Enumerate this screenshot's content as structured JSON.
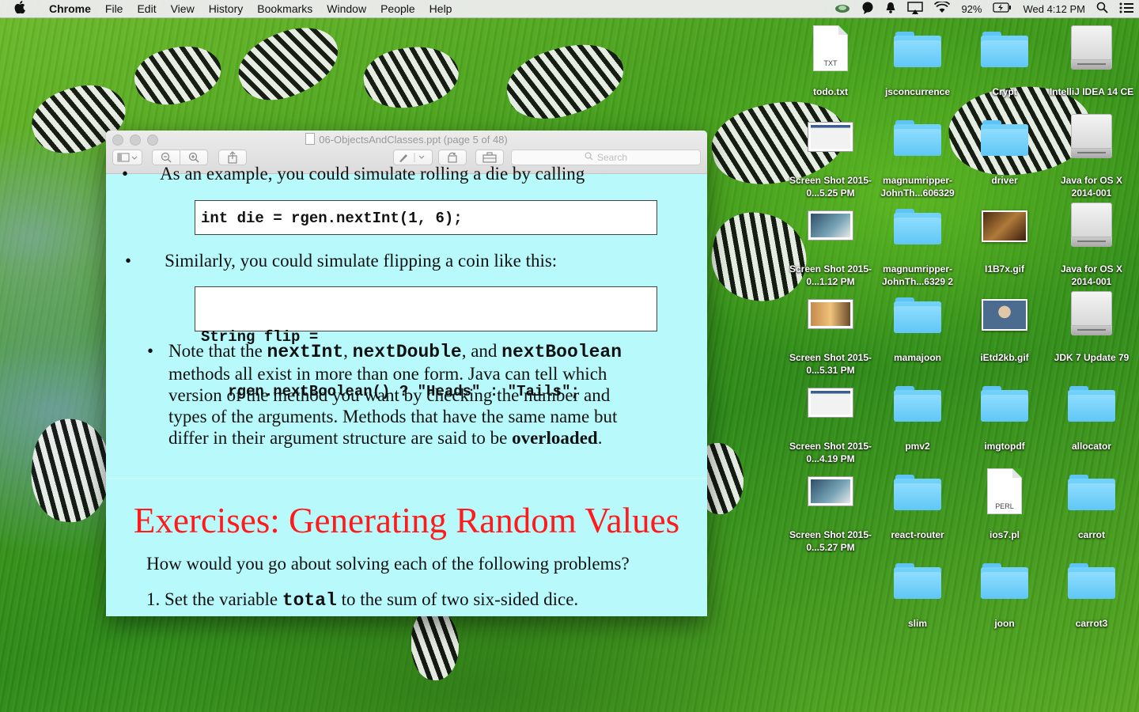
{
  "menubar": {
    "app_name": "Chrome",
    "items": [
      "File",
      "Edit",
      "View",
      "History",
      "Bookmarks",
      "Window",
      "People",
      "Help"
    ],
    "battery": "92%",
    "clock": "Wed 4:12 PM"
  },
  "preview": {
    "title": "06-ObjectsAndClasses.ppt (page 5 of 48)",
    "search_placeholder": "Search",
    "slide": {
      "line_cut": "As an example, you could simulate rolling a die by calling",
      "code1": "int die = rgen.nextInt(1, 6);",
      "bullet2": "Similarly, you could simulate flipping a coin like this:",
      "code2_line1": "String flip =",
      "code2_line2": "   rgen.nextBoolean() ? \"Heads\" : \"Tails\";",
      "note_prefix": "Note that the",
      "note_m1": "nextInt",
      "note_m2": "nextDouble",
      "note_and": ", and",
      "note_m3": "nextBoolean",
      "note_line2": "methods all exist in more than one form.  Java can tell which",
      "note_line3": "version of the method you want by checking the number and",
      "note_line4": "types of the arguments.  Methods that have the same name but",
      "note_line5_prefix": "differ in their argument structure are said to be",
      "note_overloaded": "overloaded",
      "ex_title": "Exercises: Generating Random Values",
      "ex_question": "How would you go about solving each of the following problems?",
      "ex_item1_prefix": "1.  Set the variable",
      "ex_item1_var": "total",
      "ex_item1_suffix": "to the sum of two six-sided dice."
    }
  },
  "desktop_icons": [
    {
      "label": "todo.txt",
      "type": "file",
      "ext": "TXT"
    },
    {
      "label": "jsconcurrence",
      "type": "folder"
    },
    {
      "label": "Crypt",
      "type": "folder"
    },
    {
      "label": "IntelliJ IDEA 14 CE",
      "type": "drive"
    },
    {
      "label": "Screen Shot 2015-0...5.25 PM",
      "type": "screenshot"
    },
    {
      "label": "magnumripper-JohnTh...606329",
      "type": "folder"
    },
    {
      "label": "driver",
      "type": "folder"
    },
    {
      "label": "Java for OS X 2014-001",
      "type": "drive"
    },
    {
      "label": "Screen Shot 2015-0...1.12 PM",
      "type": "screenshot"
    },
    {
      "label": "magnumripper-JohnTh...6329 2",
      "type": "folder"
    },
    {
      "label": "I1B7x.gif",
      "type": "photo"
    },
    {
      "label": "Java for OS X 2014-001",
      "type": "drive"
    },
    {
      "label": "Screen Shot 2015-0...5.31 PM",
      "type": "screenshot"
    },
    {
      "label": "mamajoon",
      "type": "folder"
    },
    {
      "label": "iEtd2kb.gif",
      "type": "photo"
    },
    {
      "label": "JDK 7 Update 79",
      "type": "drive"
    },
    {
      "label": "Screen Shot 2015-0...4.19 PM",
      "type": "screenshot"
    },
    {
      "label": "pmv2",
      "type": "folder"
    },
    {
      "label": "imgtopdf",
      "type": "folder"
    },
    {
      "label": "allocator",
      "type": "folder"
    },
    {
      "label": "Screen Shot 2015-0...5.27 PM",
      "type": "screenshot"
    },
    {
      "label": "react-router",
      "type": "folder"
    },
    {
      "label": "ios7.pl",
      "type": "file",
      "ext": "PERL"
    },
    {
      "label": "carrot",
      "type": "folder"
    },
    {
      "label": "slim",
      "type": "folder"
    },
    {
      "label": "joon",
      "type": "folder"
    },
    {
      "label": "carrot3",
      "type": "folder"
    }
  ]
}
